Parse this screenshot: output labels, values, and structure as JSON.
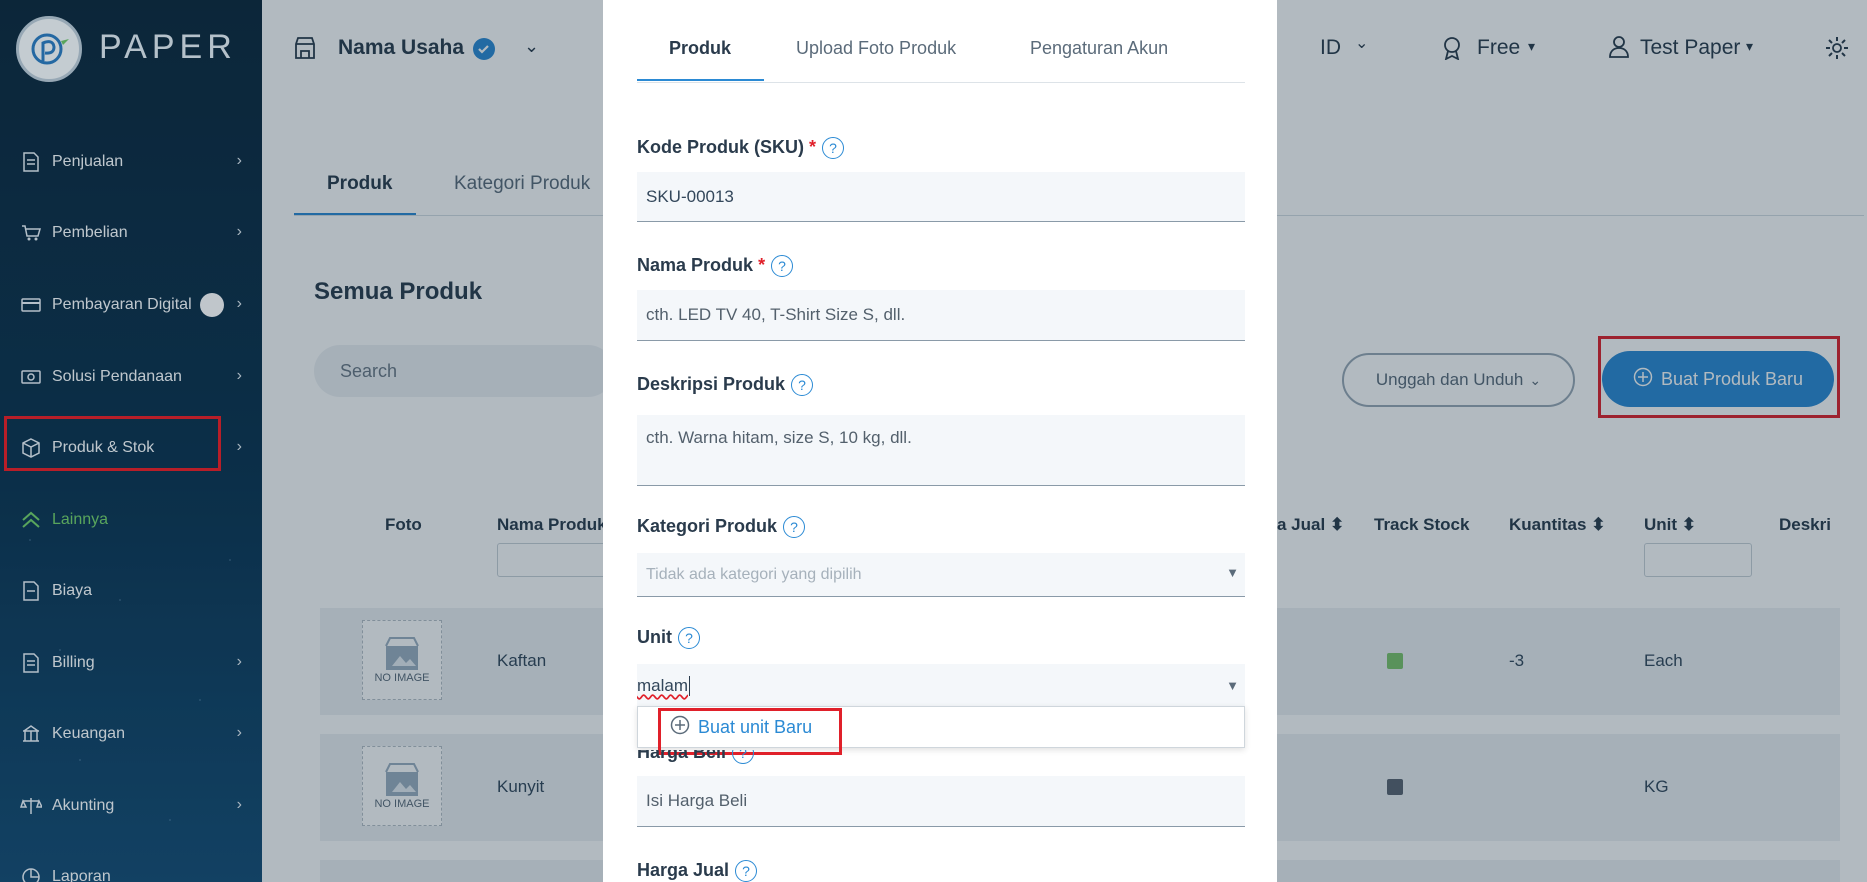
{
  "brand": {
    "name": "PAPER"
  },
  "sidebar": {
    "items": [
      {
        "label": "Penjualan",
        "icon": "document-icon"
      },
      {
        "label": "Pembelian",
        "icon": "cart-icon"
      },
      {
        "label": "Pembayaran Digital",
        "icon": "card-icon"
      },
      {
        "label": "Solusi Pendanaan",
        "icon": "cash-icon"
      },
      {
        "label": "Produk & Stok",
        "icon": "box-icon"
      },
      {
        "label": "Lainnya",
        "icon": "double-chevron-up-icon"
      },
      {
        "label": "Biaya",
        "icon": "document-icon"
      },
      {
        "label": "Billing",
        "icon": "document-icon"
      },
      {
        "label": "Keuangan",
        "icon": "bank-icon"
      },
      {
        "label": "Akunting",
        "icon": "scale-icon"
      },
      {
        "label": "Laporan",
        "icon": "pie-chart-icon"
      }
    ],
    "active_color": "#6cc56a"
  },
  "header": {
    "business_name": "Nama Usaha",
    "language": "ID",
    "plan": "Free",
    "user": "Test Paper"
  },
  "page": {
    "tabs": [
      "Produk",
      "Kategori Produk"
    ],
    "title": "Semua Produk",
    "search_placeholder": "Search",
    "upload_button": "Unggah dan Unduh",
    "create_button": "Buat Produk Baru"
  },
  "table": {
    "headers": [
      "Foto",
      "Nama Produk",
      "a Jual",
      "Track Stock",
      "Kuantitas",
      "Unit",
      "Deskri"
    ],
    "no_image_label": "NO IMAGE",
    "rows": [
      {
        "name": "Kaftan",
        "quantity": "-3",
        "unit": "Each",
        "track_color": "#7cc46a"
      },
      {
        "name": "Kunyit",
        "quantity": "",
        "unit": "KG",
        "track_color": "#5b6470"
      }
    ]
  },
  "modal": {
    "tabs": [
      "Produk",
      "Upload Foto Produk",
      "Pengaturan Akun"
    ],
    "sku_label": "Kode Produk (SKU)",
    "sku_value": "SKU-00013",
    "name_label": "Nama Produk",
    "name_placeholder": "cth. LED TV 40, T-Shirt Size S, dll.",
    "desc_label": "Deskripsi Produk",
    "desc_placeholder": "cth. Warna hitam, size S, 10 kg, dll.",
    "category_label": "Kategori Produk",
    "category_placeholder": "Tidak ada kategori yang dipilih",
    "unit_label": "Unit",
    "unit_value": "malam",
    "create_unit_option": "Buat unit Baru",
    "buy_price_label": "Harga Beli",
    "buy_price_placeholder": "Isi Harga Beli",
    "sell_price_label": "Harga Jual",
    "required_mark": "*",
    "help_mark": "?"
  },
  "colors": {
    "accent": "#2b8ad4",
    "highlight": "#e0202a"
  }
}
